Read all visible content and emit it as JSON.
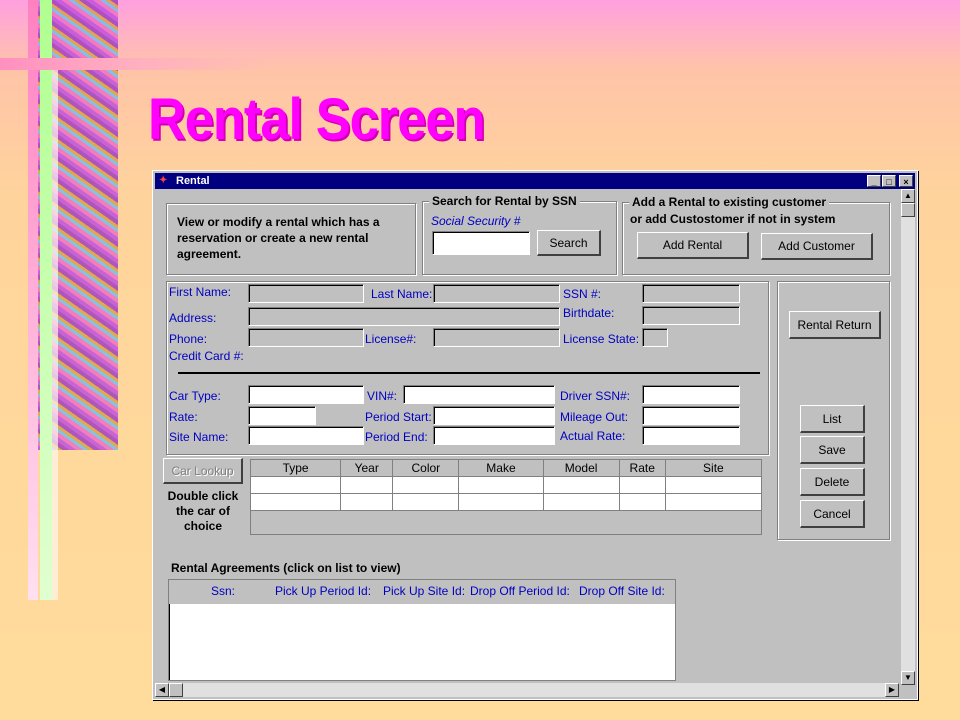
{
  "slide_title": "Rental Screen",
  "window": {
    "title": "Rental",
    "buttons": {
      "min": "_",
      "max": "□",
      "close": "×"
    }
  },
  "intro_text": "View or modify a rental which has a reservation or create a new rental agreement.",
  "search": {
    "group_label": "Search for Rental by SSN",
    "ssn_label": "Social Security #",
    "ssn_value": "",
    "search_button": "Search"
  },
  "add": {
    "group_label_line1": "Add a Rental to existing customer",
    "group_label_line2": "or add Custostomer if not in system",
    "add_rental_button": "Add Rental",
    "add_customer_button": "Add Customer"
  },
  "customer": {
    "first_name": "First Name:",
    "last_name": "Last Name:",
    "ssn": "SSN #:",
    "address": "Address:",
    "birthdate": "Birthdate:",
    "phone": "Phone:",
    "license": "License#:",
    "license_state": "License State:",
    "credit_card": "Credit Card #:"
  },
  "car": {
    "car_type": "Car Type:",
    "vin": "VIN#:",
    "driver_ssn": "Driver SSN#:",
    "rate": "Rate:",
    "period_start": "Period Start:",
    "mileage_out": "Mileage Out:",
    "site_name": "Site Name:",
    "period_end": "Period End:",
    "actual_rate": "Actual Rate:"
  },
  "car_lookup": {
    "button": "Car Lookup",
    "hint": "Double click the car of choice"
  },
  "car_grid": {
    "columns": [
      "Type",
      "Year",
      "Color",
      "Make",
      "Model",
      "Rate",
      "Site"
    ]
  },
  "side_buttons": {
    "rental_return": "Rental Return",
    "list": "List",
    "save": "Save",
    "delete": "Delete",
    "cancel": "Cancel"
  },
  "agreements": {
    "title": "Rental Agreements (click on list to view)",
    "columns": [
      "Ssn:",
      "Pick Up Period Id:",
      "Pick Up Site Id:",
      "Drop Off Period Id:",
      "Drop Off Site Id:"
    ]
  }
}
